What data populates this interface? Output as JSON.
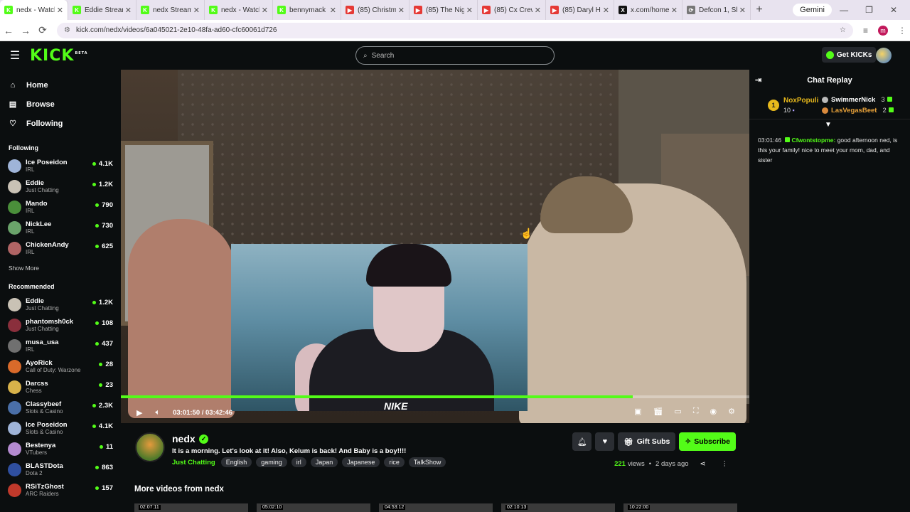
{
  "browser": {
    "tabs": [
      {
        "label": "nedx - Watch",
        "icon_color": "#53fc18",
        "icon_letter": "K",
        "active": true
      },
      {
        "label": "Eddie Stream",
        "icon_color": "#53fc18",
        "icon_letter": "K",
        "active": false
      },
      {
        "label": "nedx Stream",
        "icon_color": "#53fc18",
        "icon_letter": "K",
        "active": false
      },
      {
        "label": "nedx - Watch",
        "icon_color": "#53fc18",
        "icon_letter": "K",
        "active": false
      },
      {
        "label": "bennymack -",
        "icon_color": "#53fc18",
        "icon_letter": "K",
        "active": false
      },
      {
        "label": "(85) Christma",
        "icon_color": "#e53935",
        "icon_letter": "▶",
        "active": false
      },
      {
        "label": "(85) The Nigh",
        "icon_color": "#e53935",
        "icon_letter": "▶",
        "active": false
      },
      {
        "label": "(85) Cx Crew",
        "icon_color": "#e53935",
        "icon_letter": "▶",
        "active": false
      },
      {
        "label": "(85) Daryl Hal",
        "icon_color": "#e53935",
        "icon_letter": "▶",
        "active": false
      },
      {
        "label": "x.com/home",
        "icon_color": "#111111",
        "icon_letter": "X",
        "active": false
      },
      {
        "label": "Defcon 1, Sh",
        "icon_color": "#777777",
        "icon_letter": "⟳",
        "active": false
      }
    ],
    "gemini_label": "Gemini",
    "url": "kick.com/nedx/videos/6a045021-2e10-48fa-ad60-cfc60061d726",
    "profile_letter": "m"
  },
  "header": {
    "logo": "KICK",
    "beta": "BETA",
    "search_placeholder": "Search",
    "get_kicks": "Get KICKs"
  },
  "sidebar": {
    "nav": [
      {
        "label": "Home",
        "icon": "home-icon",
        "glyph": "⌂"
      },
      {
        "label": "Browse",
        "icon": "browse-icon",
        "glyph": "▤"
      },
      {
        "label": "Following",
        "icon": "heart-icon",
        "glyph": "♡"
      }
    ],
    "following_title": "Following",
    "following": [
      {
        "name": "Ice Poseidon",
        "category": "IRL",
        "viewers": "4.1K",
        "color": "#9fb4d8"
      },
      {
        "name": "Eddie",
        "category": "Just Chatting",
        "viewers": "1.2K",
        "color": "#c9c2b5"
      },
      {
        "name": "Mando",
        "category": "IRL",
        "viewers": "790",
        "color": "#4a8f3a"
      },
      {
        "name": "NickLee",
        "category": "IRL",
        "viewers": "730",
        "color": "#6aa36a"
      },
      {
        "name": "ChickenAndy",
        "category": "IRL",
        "viewers": "625",
        "color": "#b06464"
      }
    ],
    "show_more": "Show More",
    "recommended_title": "Recommended",
    "recommended": [
      {
        "name": "Eddie",
        "category": "Just Chatting",
        "viewers": "1.2K",
        "color": "#c9c2b5"
      },
      {
        "name": "phantomsh0ck",
        "category": "Just Chatting",
        "viewers": "108",
        "color": "#8a2f3c"
      },
      {
        "name": "musa_usa",
        "category": "IRL",
        "viewers": "437",
        "color": "#707070"
      },
      {
        "name": "AyoRick",
        "category": "Call of Duty: Warzone",
        "viewers": "28",
        "color": "#d96a2a"
      },
      {
        "name": "Darcss",
        "category": "Chess",
        "viewers": "23",
        "color": "#d8b24a"
      },
      {
        "name": "Classybeef",
        "category": "Slots & Casino",
        "viewers": "2.3K",
        "color": "#4a6fa8"
      },
      {
        "name": "Ice Poseidon",
        "category": "Slots & Casino",
        "viewers": "4.1K",
        "color": "#9fb4d8"
      },
      {
        "name": "Bestenya",
        "category": "VTubers",
        "viewers": "11",
        "color": "#b48ad0"
      },
      {
        "name": "BLASTDota",
        "category": "Dota 2",
        "viewers": "863",
        "color": "#2f4fa0"
      },
      {
        "name": "RSiTzGhost",
        "category": "ARC Raiders",
        "viewers": "157",
        "color": "#c0392b"
      }
    ]
  },
  "player": {
    "current_time": "03:01:50",
    "duration": "03:42:46",
    "time_display": "03:01:50 / 03:42:46",
    "progress_fraction": 0.815,
    "pip_shirt_text": "NIKE"
  },
  "chat": {
    "title": "Chat Replay",
    "leader1": {
      "name": "NoxPopuli",
      "count": "10",
      "rank": "1"
    },
    "leader2": {
      "name": "SwimmerNick",
      "count": "3"
    },
    "leader3": {
      "name": "LasVegasBeet",
      "count": "2"
    },
    "message": {
      "time": "03:01:46",
      "user": "Cfwontstopme:",
      "text": " good afternoon ned, is this your family! nice to meet your mom, dad, and sister"
    }
  },
  "channel": {
    "name": "nedx",
    "title": "It is a morning. Let's look at it! Also, Kelum is back! And Baby is a boy!!!!",
    "category": "Just Chatting",
    "tags": [
      "English",
      "gaming",
      "irl",
      "Japan",
      "Japanese",
      "rice",
      "TalkShow"
    ],
    "gift_subs": "Gift Subs",
    "subscribe": "Subscribe",
    "views": "221",
    "views_label": "views",
    "ago": "2 days ago",
    "more_videos": "More videos from nedx",
    "thumb_durations": [
      "02:07:11",
      "05:02:10",
      "04:53:12",
      "02:10:13",
      "10:22:00"
    ]
  },
  "colors": {
    "accent": "#53fc18",
    "bg": "#0b0e0f"
  }
}
